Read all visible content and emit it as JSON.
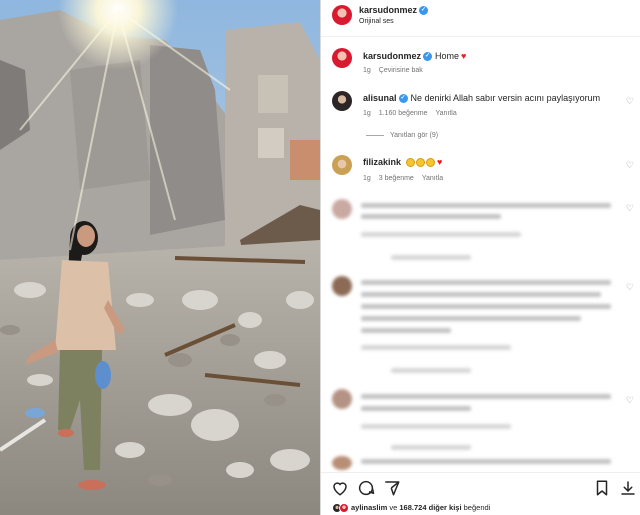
{
  "post": {
    "author": "karsudonmez",
    "audio": "Orijinal ses"
  },
  "caption": {
    "author": "karsudonmez",
    "text": "Home",
    "time": "1g",
    "translate": "Çevirisine bak"
  },
  "comments": [
    {
      "author": "alisunal",
      "text": "Ne denirki Allah sabır versin acını paylaşıyorum",
      "time": "1g",
      "likes": "1.160 beğenme",
      "reply": "Yanıtla",
      "view_replies": "Yanıtları gör (9)"
    },
    {
      "author": "filizakink",
      "time": "1g",
      "likes": "3 beğenme",
      "reply": "Yanıtla"
    }
  ],
  "liked_by": {
    "user": "aylinaslim",
    "and_text": "ve",
    "count": "168.724",
    "others_text": "diğer kişi",
    "liked_text": "beğendi"
  },
  "colors": {
    "verified": "#3897f0",
    "heart": "#ed1c24",
    "text": "#262626",
    "muted": "#737373"
  },
  "icons": [
    "heart-icon",
    "comment-icon",
    "share-icon",
    "bookmark-icon",
    "download-icon",
    "verified-icon"
  ]
}
